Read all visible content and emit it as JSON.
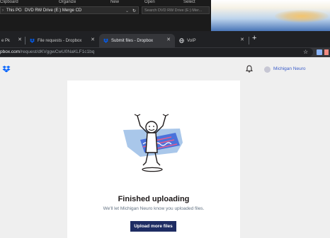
{
  "explorer": {
    "ribbon": {
      "clipboard": "Clipboard",
      "organize": "Organize",
      "new": "New",
      "open": "Open",
      "select": "Select"
    },
    "address": {
      "this_pc": "This PC",
      "drive": "DVD RW Drive (E:) Merge CD"
    },
    "search_placeholder": "Search DVD RW Drive (E:) Mer..."
  },
  "tabs": [
    {
      "label": "e Pk"
    },
    {
      "label": "File requests - Dropbox"
    },
    {
      "label": "Submit files - Dropbox",
      "active": true
    },
    {
      "label": "VoIP"
    }
  ],
  "url": {
    "host": "pbox.com",
    "path": "/request/dKVggwCwU0NaKLF1c1bq"
  },
  "header": {
    "account_name": "Michigan Neuro"
  },
  "card": {
    "title": "Finished uploading",
    "subtitle": "We'll let Michigan Neuro know you uploaded files.",
    "button_label": "Upload more files"
  },
  "colors": {
    "accent": "#0061fe",
    "button": "#1e2c63",
    "page_bg": "#efefef"
  }
}
